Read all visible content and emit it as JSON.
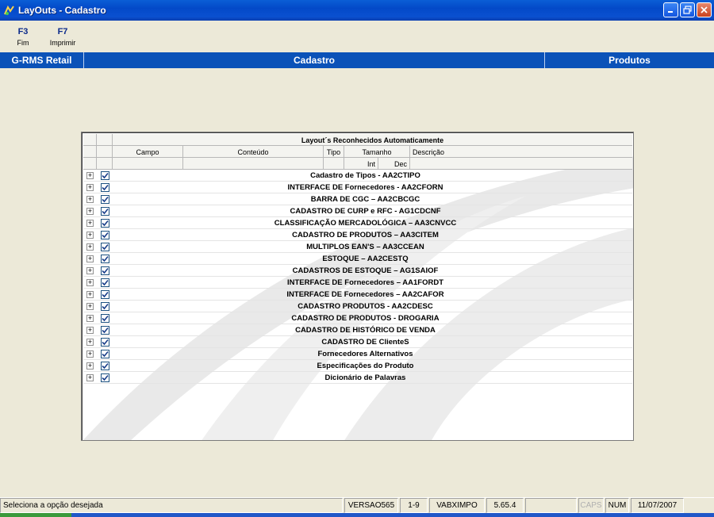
{
  "window": {
    "title": "LayOuts - Cadastro",
    "controls": [
      "minimize-icon",
      "maximize-icon",
      "close-icon"
    ]
  },
  "toolbar": {
    "items": [
      {
        "key": "F3",
        "label": "Fim"
      },
      {
        "key": "F7",
        "label": "Imprimir"
      }
    ]
  },
  "band": {
    "system": "G-RMS Retail",
    "module": "Cadastro",
    "section": "Produtos"
  },
  "grid": {
    "caption": "Layout´s Reconhecidos Automaticamente",
    "headers": {
      "campo": "Campo",
      "conteudo": "Conteúdo",
      "tipo": "Tipo",
      "tamanho": "Tamanho",
      "descricao": "Descrição",
      "int": "Int",
      "dec": "Dec"
    },
    "rows": [
      "Cadastro de Tipos - AA2CTIPO",
      "INTERFACE DE Fornecedores - AA2CFORN",
      "BARRA DE CGC – AA2CBCGC",
      "CADASTRO DE CURP e RFC - AG1CDCNF",
      "CLASSIFICAÇÃO MERCADOLÓGICA – AA3CNVCC",
      "CADASTRO DE PRODUTOS – AA3CITEM",
      "MULTIPLOS EAN'S – AA3CCEAN",
      "ESTOQUE – AA2CESTQ",
      "CADASTROS DE ESTOQUE – AG1SAIOF",
      "INTERFACE DE Fornecedores – AA1FORDT",
      "INTERFACE DE Fornecedores – AA2CAFOR",
      "CADASTRO PRODUTOS - AA2CDESC",
      "CADASTRO DE PRODUTOS - DROGARIA",
      "CADASTRO DE HISTÓRICO DE VENDA",
      "CADASTRO DE ClienteS",
      "Fornecedores Alternativos",
      "Especificações do Produto",
      "Dicionário de Palavras"
    ],
    "all_checked": true
  },
  "status": {
    "message": "Seleciona a opção desejada",
    "version": "VERSAO565",
    "page": "1-9",
    "program": "VABXIMPO",
    "build": "5.65.4",
    "empty": "",
    "caps": "CAPS",
    "num": "NUM",
    "date": "11/07/2007"
  },
  "colors": {
    "band": "#0b52b8",
    "titlebar": "#0a5ed6",
    "background": "#ece9d8"
  }
}
